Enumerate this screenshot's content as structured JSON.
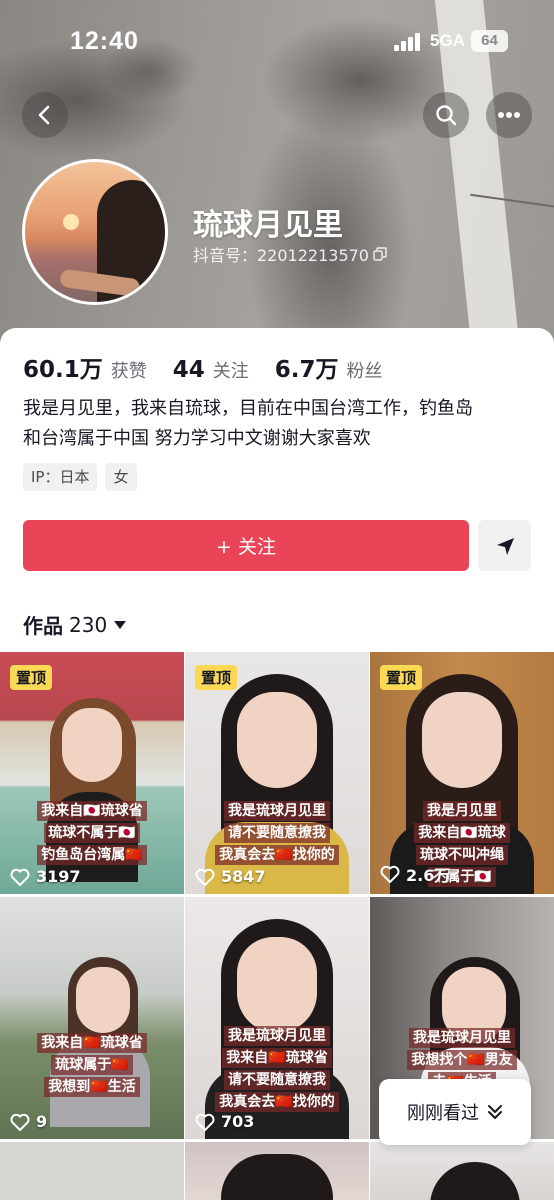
{
  "status_bar": {
    "time": "12:40",
    "network": "5GA",
    "battery": "64"
  },
  "profile": {
    "nickname": "琉球月见里",
    "douyin_id": "抖音号：22012213570",
    "stats": [
      {
        "value": "60.1万",
        "label": "获赞"
      },
      {
        "value": "44",
        "label": "关注"
      },
      {
        "value": "6.7万",
        "label": "粉丝"
      }
    ],
    "bio_line1": "我是月见里，我来自琉球，目前在中国台湾工作，钓鱼岛",
    "bio_line2": "和台湾属于中国 努力学习中文谢谢大家喜欢",
    "tags": [
      "IP：日本",
      "女"
    ],
    "follow_label": "+ 关注"
  },
  "works": {
    "label": "作品",
    "count": "230"
  },
  "grid": [
    {
      "pinned": true,
      "pin_label": "置顶",
      "caption": [
        "我来自🇯🇵琉球省",
        "琉球不属于🇯🇵",
        "钓鱼岛台湾属🇨🇳"
      ],
      "likes": "3197"
    },
    {
      "pinned": true,
      "pin_label": "置顶",
      "caption": [
        "我是琉球月见里",
        "请不要随意撩我",
        "我真会去🇨🇳找你的"
      ],
      "likes": "5847"
    },
    {
      "pinned": true,
      "pin_label": "置顶",
      "caption": [
        "我是月见里",
        "我来自🇯🇵琉球",
        "琉球不叫冲绳",
        "不属于🇯🇵"
      ],
      "likes": "2.6万"
    },
    {
      "pinned": false,
      "pin_label": "",
      "caption": [
        "我来自🇨🇳琉球省",
        "琉球属于🇨🇳",
        "我想到🇨🇳生活"
      ],
      "likes": "9"
    },
    {
      "pinned": false,
      "pin_label": "",
      "caption": [
        "我是琉球月见里",
        "我来自🇨🇳琉球省",
        "请不要随意撩我",
        "我真会去🇨🇳找你的"
      ],
      "likes": "703"
    },
    {
      "pinned": false,
      "pin_label": "",
      "caption": [
        "我是琉球月见里",
        "我想找个🇨🇳男友",
        "去🇨🇳生活"
      ],
      "likes": ""
    }
  ],
  "recent_button": {
    "label": "刚刚看过"
  },
  "colors": {
    "accent": "#ea4459",
    "pin": "#fcd955"
  }
}
